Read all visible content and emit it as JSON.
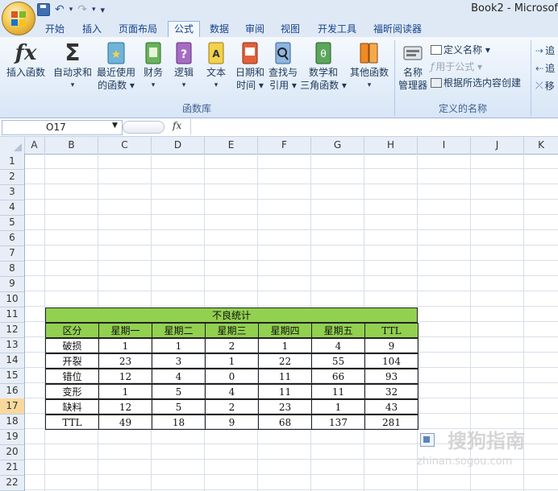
{
  "window": {
    "title": "Book2 - Microsof"
  },
  "quick_access": {
    "save_icon": "save-icon",
    "undo_icon": "undo-icon",
    "redo_icon": "redo-icon",
    "customize": "▾"
  },
  "tabs": [
    "开始",
    "插入",
    "页面布局",
    "公式",
    "数据",
    "审阅",
    "视图",
    "开发工具",
    "福昕阅读器"
  ],
  "active_tab": "公式",
  "ribbon": {
    "function_library": {
      "label": "函数库",
      "buttons": [
        {
          "line1": "插入函数",
          "line2": "",
          "icon": "fx-icon"
        },
        {
          "line1": "自动求和",
          "line2": "▾",
          "icon": "sigma-icon"
        },
        {
          "line1": "最近使用",
          "line2": "的函数 ▾",
          "icon": "star-book-icon"
        },
        {
          "line1": "财务",
          "line2": "▾",
          "icon": "finance-book-icon"
        },
        {
          "line1": "逻辑",
          "line2": "▾",
          "icon": "question-book-icon"
        },
        {
          "line1": "文本",
          "line2": "▾",
          "icon": "text-book-icon"
        },
        {
          "line1": "日期和",
          "line2": "时间 ▾",
          "icon": "calendar-book-icon"
        },
        {
          "line1": "查找与",
          "line2": "引用 ▾",
          "icon": "search-book-icon"
        },
        {
          "line1": "数学和",
          "line2": "三角函数 ▾",
          "icon": "theta-book-icon"
        },
        {
          "line1": "其他函数",
          "line2": "▾",
          "icon": "more-books-icon"
        }
      ]
    },
    "defined_names": {
      "label": "定义的名称",
      "name_manager": {
        "line1": "名称",
        "line2": "管理器"
      },
      "define_name": "定义名称 ▾",
      "use_in_formula": "用于公式 ▾",
      "create_from_selection": "根据所选内容创建"
    },
    "formula_auditing_partial": [
      "追",
      "追",
      "移"
    ]
  },
  "formula_bar": {
    "name_box": "O17",
    "fx": "fx",
    "value": ""
  },
  "columns": [
    "A",
    "B",
    "C",
    "D",
    "E",
    "F",
    "G",
    "H",
    "I",
    "J",
    "K"
  ],
  "rows": [
    "1",
    "2",
    "3",
    "4",
    "5",
    "6",
    "7",
    "8",
    "9",
    "10",
    "11",
    "12",
    "13",
    "14",
    "15",
    "16",
    "17",
    "18",
    "19",
    "20",
    "21",
    "22"
  ],
  "selected_row": "17",
  "table": {
    "title": "不良统计",
    "headers": [
      "区分",
      "星期一",
      "星期二",
      "星期三",
      "星期四",
      "星期五",
      "TTL"
    ],
    "rows": [
      [
        "破损",
        "1",
        "1",
        "2",
        "1",
        "4",
        "9"
      ],
      [
        "开裂",
        "23",
        "3",
        "1",
        "22",
        "55",
        "104"
      ],
      [
        "错位",
        "12",
        "4",
        "0",
        "11",
        "66",
        "93"
      ],
      [
        "变形",
        "1",
        "5",
        "4",
        "11",
        "11",
        "32"
      ],
      [
        "缺料",
        "12",
        "5",
        "2",
        "23",
        "1",
        "43"
      ],
      [
        "TTL",
        "49",
        "18",
        "9",
        "68",
        "137",
        "281"
      ]
    ]
  },
  "watermark": {
    "line1": "搜狗指南",
    "line2": "zhinan.sogou.com"
  },
  "colors": {
    "header_green": "#92d050",
    "selected_row": "#f9d99b"
  }
}
